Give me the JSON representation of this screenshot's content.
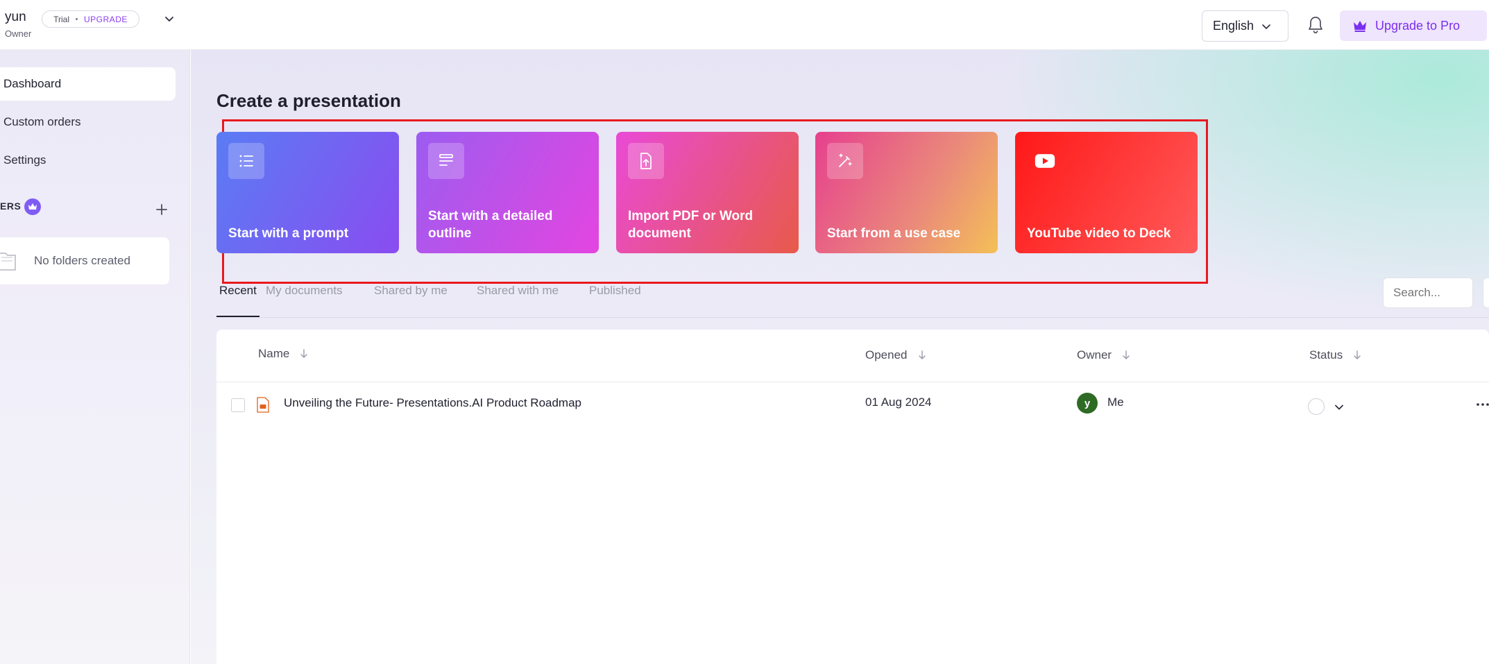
{
  "user": {
    "name": "yun",
    "role": "Owner",
    "plan": "Trial",
    "upgrade_link": "UPGRADE"
  },
  "header": {
    "language": "English",
    "upgrade_button": "Upgrade to Pro",
    "accent_color": "#7b2ff0"
  },
  "sidebar": {
    "items": [
      {
        "label": "Dashboard",
        "active": true
      },
      {
        "label": "Custom orders",
        "active": false
      },
      {
        "label": "Settings",
        "active": false
      }
    ],
    "folders_label": "ERS",
    "empty_folders": "No folders created"
  },
  "main": {
    "title": "Create a presentation",
    "cards": [
      {
        "label": "Start with a prompt",
        "icon": "list-icon"
      },
      {
        "label": "Start with a detailed outline",
        "icon": "outline-icon"
      },
      {
        "label": "Import PDF or Word document",
        "icon": "file-upload-icon"
      },
      {
        "label": "Start from a use case",
        "icon": "magic-wand-icon"
      },
      {
        "label": "YouTube video to Deck",
        "icon": "youtube-icon"
      }
    ],
    "highlight_color": "#e8191f",
    "tabs": [
      "Recent",
      "My documents",
      "Shared by me",
      "Shared with me",
      "Published"
    ],
    "active_tab": "Recent",
    "search_placeholder": "Search..."
  },
  "table": {
    "columns": [
      "Name",
      "Opened",
      "Owner",
      "Status"
    ],
    "rows": [
      {
        "name": "Unveiling the Future- Presentations.AI Product Roadmap",
        "opened": "01 Aug 2024",
        "owner_initial": "y",
        "owner": "Me"
      }
    ]
  }
}
